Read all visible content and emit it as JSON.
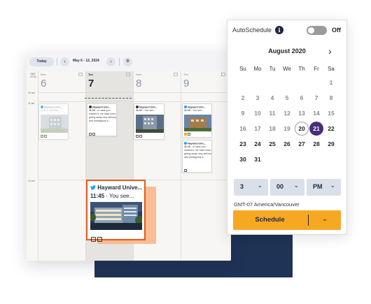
{
  "toolbar": {
    "today_label": "Today",
    "prev_icon": "chevron-left-icon",
    "next_icon": "chevron-right-icon",
    "range_label": "May 6 - 12, 2024",
    "settings_icon": "gear-icon"
  },
  "calendar": {
    "timezone_label": "GMT -07:00",
    "days": [
      {
        "name": "Mon",
        "number": "6"
      },
      {
        "name": "Tue",
        "number": "7"
      },
      {
        "name": "Wed",
        "number": "8"
      },
      {
        "name": "Thu",
        "number": "9"
      }
    ],
    "time_labels": [
      "10 am",
      "11 am",
      "12 pm"
    ]
  },
  "cards": {
    "mon": {
      "title": "Hayward Univ...",
      "time": "11:10",
      "text": "- You see..."
    },
    "tue": {
      "title": "Hayward Univ...",
      "time": "11:10",
      "text": "- In case you missed it, we have been giving away very serious and prestigious a..."
    },
    "wed": {
      "title": "Hayward Univ...",
      "time": "11:10",
      "text": "- You see..."
    },
    "thu1": {
      "title": "Hayward Univ...",
      "time": "11:10",
      "text": "- You see..."
    },
    "thu2": {
      "title": "Hayward Univ...",
      "time": "11:10",
      "text": "- In case you missed it, we have been giving away very serious and prestigious a..."
    }
  },
  "featured": {
    "title": "Hayward Unive...",
    "time": "11:45",
    "text": "- You see...",
    "network_icon": "twitter-icon"
  },
  "autoschedule": {
    "label": "AutoSchedule",
    "info_icon": "info-icon",
    "toggle_state": "Off"
  },
  "datepicker": {
    "month_label": "August 2020",
    "weekdays": [
      "Su",
      "Mo",
      "Tu",
      "We",
      "Th",
      "Fr",
      "Sa"
    ],
    "weeks": [
      [
        "",
        "",
        "",
        "",
        "",
        "",
        "1"
      ],
      [
        "2",
        "3",
        "4",
        "5",
        "6",
        "7",
        "8"
      ],
      [
        "9",
        "10",
        "11",
        "12",
        "13",
        "14",
        "15"
      ],
      [
        "16",
        "17",
        "18",
        "19",
        "20",
        "21",
        "22"
      ],
      [
        "23",
        "24",
        "25",
        "26",
        "27",
        "28",
        "29"
      ],
      [
        "30",
        "31",
        "",
        "",
        "",
        "",
        ""
      ]
    ],
    "today": "20",
    "selected": "21",
    "hour": "3",
    "minute": "00",
    "ampm": "PM",
    "timezone": "GMT-07 America/Vancouver",
    "schedule_label": "Schedule"
  },
  "colors": {
    "accent_orange": "#f7a823",
    "selected_purple": "#4a2d7a",
    "navy": "#1f3356",
    "twitter_blue": "#1da1f2",
    "card_border_orange": "#e85a1a"
  }
}
